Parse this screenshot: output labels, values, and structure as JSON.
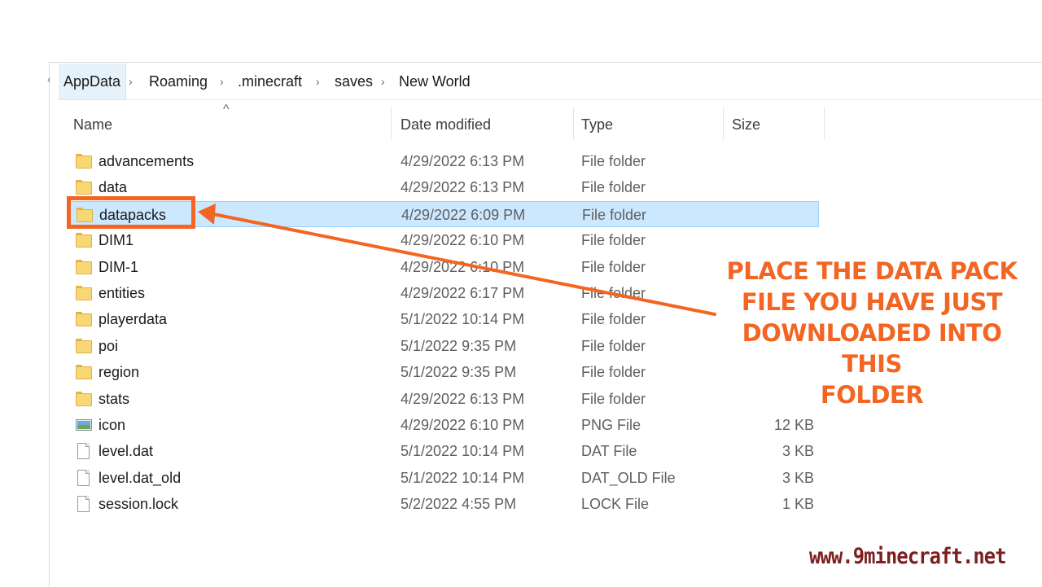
{
  "breadcrumb": {
    "items": [
      "AppData",
      "Roaming",
      ".minecraft",
      "saves",
      "New World"
    ],
    "separator": "›"
  },
  "columns": {
    "name": "Name",
    "date": "Date modified",
    "type": "Type",
    "size": "Size",
    "sort_indicator": "^"
  },
  "files": [
    {
      "icon": "folder-icon",
      "name": "advancements",
      "date": "4/29/2022 6:13 PM",
      "type": "File folder",
      "size": ""
    },
    {
      "icon": "folder-icon",
      "name": "data",
      "date": "4/29/2022 6:13 PM",
      "type": "File folder",
      "size": ""
    },
    {
      "icon": "folder-icon",
      "name": "datapacks",
      "date": "4/29/2022 6:09 PM",
      "type": "File folder",
      "size": "",
      "selected": true
    },
    {
      "icon": "folder-icon",
      "name": "DIM1",
      "date": "4/29/2022 6:10 PM",
      "type": "File folder",
      "size": ""
    },
    {
      "icon": "folder-icon",
      "name": "DIM-1",
      "date": "4/29/2022 6:10 PM",
      "type": "File folder",
      "size": ""
    },
    {
      "icon": "folder-icon",
      "name": "entities",
      "date": "4/29/2022 6:17 PM",
      "type": "File folder",
      "size": ""
    },
    {
      "icon": "folder-icon",
      "name": "playerdata",
      "date": "5/1/2022 10:14 PM",
      "type": "File folder",
      "size": ""
    },
    {
      "icon": "folder-icon",
      "name": "poi",
      "date": "5/1/2022 9:35 PM",
      "type": "File folder",
      "size": ""
    },
    {
      "icon": "folder-icon",
      "name": "region",
      "date": "5/1/2022 9:35 PM",
      "type": "File folder",
      "size": ""
    },
    {
      "icon": "folder-icon",
      "name": "stats",
      "date": "4/29/2022 6:13 PM",
      "type": "File folder",
      "size": ""
    },
    {
      "icon": "image-file-icon",
      "name": "icon",
      "date": "4/29/2022 6:10 PM",
      "type": "PNG File",
      "size": "12 KB"
    },
    {
      "icon": "file-icon",
      "name": "level.dat",
      "date": "5/1/2022 10:14 PM",
      "type": "DAT File",
      "size": "3 KB"
    },
    {
      "icon": "file-icon",
      "name": "level.dat_old",
      "date": "5/1/2022 10:14 PM",
      "type": "DAT_OLD File",
      "size": "3 KB"
    },
    {
      "icon": "file-icon",
      "name": "session.lock",
      "date": "5/2/2022 4:55 PM",
      "type": "LOCK File",
      "size": "1 KB"
    }
  ],
  "annotation": {
    "instruction_lines": [
      "PLACE THE DATA PACK",
      "FILE YOU HAVE JUST",
      "DOWNLOADED INTO THIS",
      "FOLDER"
    ],
    "color": "#f26522"
  },
  "watermark": "www.9minecraft.net",
  "colors": {
    "selection": "#cce8ff",
    "selection_border": "#99d1ff",
    "folder": "#f8d775",
    "watermark": "#7b1f1f"
  }
}
